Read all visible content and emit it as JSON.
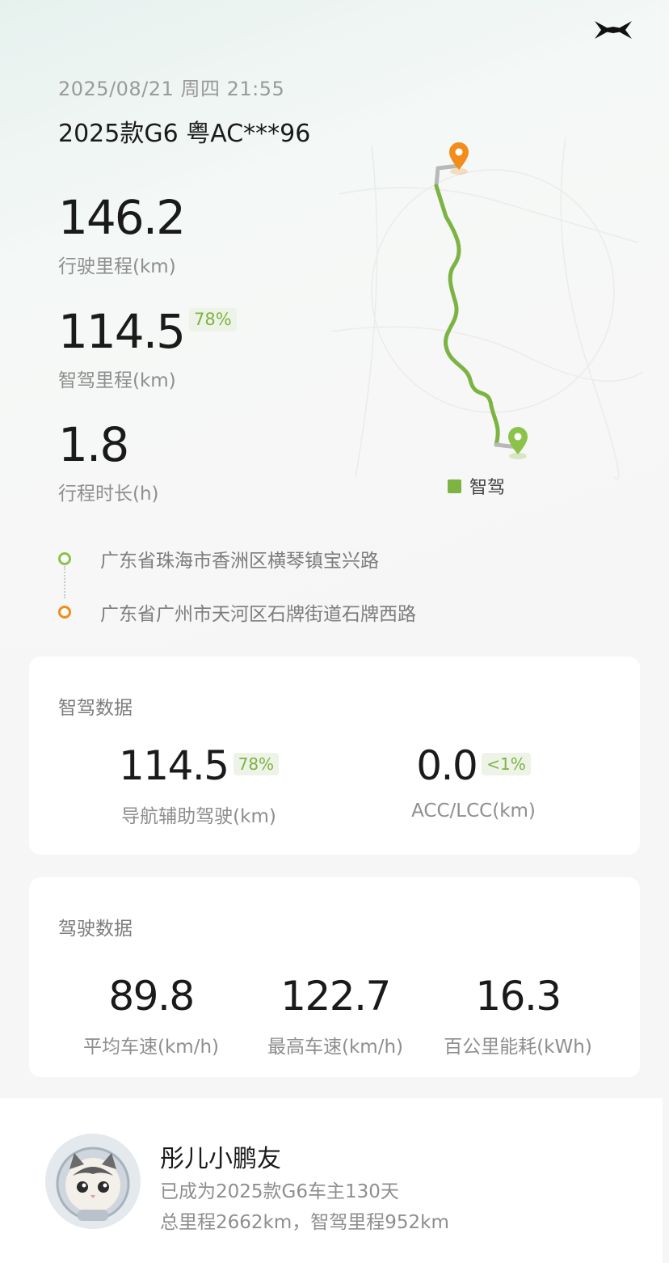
{
  "header": {
    "datetime": "2025/08/21 周四 21:55",
    "vehicle": "2025款G6 粤AC***96",
    "logo_icon": "xpeng-logo-icon"
  },
  "summary": {
    "distance": {
      "value": "146.2",
      "label": "行驶里程(km)"
    },
    "smart_distance": {
      "value": "114.5",
      "percent": "78%",
      "label": "智驾里程(km)"
    },
    "duration": {
      "value": "1.8",
      "label": "行程时长(h)"
    }
  },
  "map": {
    "legend_label": "智驾",
    "route_color": "#7cb342",
    "start_color": "#8bc34a",
    "end_color": "#f28c1b"
  },
  "route": {
    "start": "广东省珠海市香洲区横琴镇宝兴路",
    "end": "广东省广州市天河区石牌街道石牌西路"
  },
  "smart_card": {
    "title": "智驾数据",
    "nav_assist": {
      "value": "114.5",
      "percent": "78%",
      "label": "导航辅助驾驶(km)"
    },
    "acc_lcc": {
      "value": "0.0",
      "percent": "<1%",
      "label": "ACC/LCC(km)"
    }
  },
  "drive_card": {
    "title": "驾驶数据",
    "avg_speed": {
      "value": "89.8",
      "label": "平均车速(km/h)"
    },
    "max_speed": {
      "value": "122.7",
      "label": "最高车速(km/h)"
    },
    "consumption": {
      "value": "16.3",
      "label": "百公里能耗(kWh)"
    }
  },
  "profile": {
    "name": "彤儿小鹏友",
    "owner_days": "已成为2025款G6车主130天",
    "totals": "总里程2662km，智驾里程952km"
  }
}
